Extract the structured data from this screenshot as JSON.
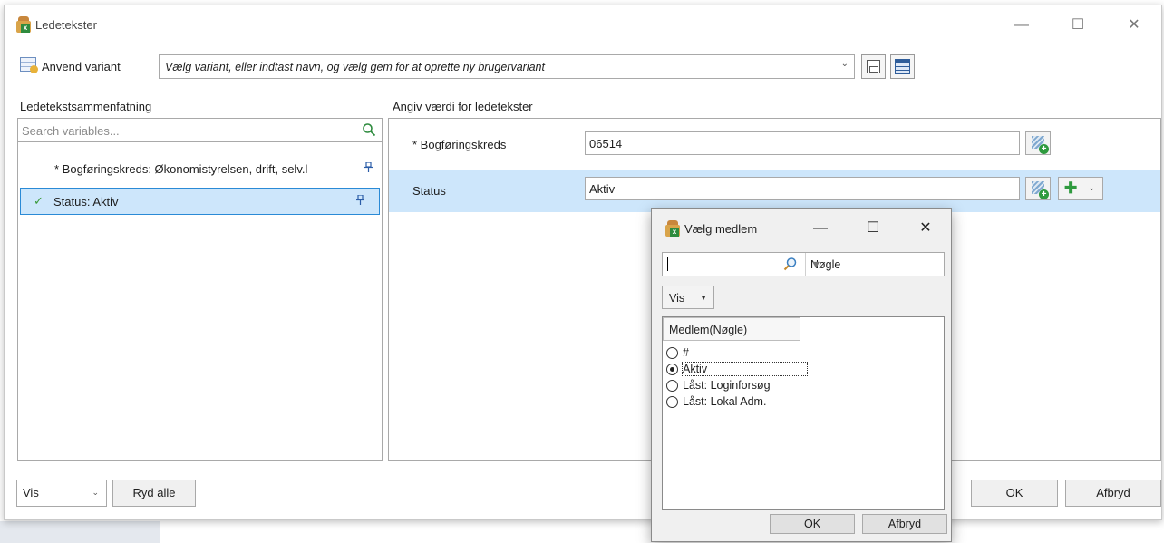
{
  "window": {
    "title": "Ledetekster",
    "minimize": "—",
    "maximize": "☐",
    "close": "✕"
  },
  "variant": {
    "label": "Anvend variant",
    "placeholder": "Vælg variant, eller indtast navn, og vælg gem for at oprette ny brugervariant",
    "arrow": "⌄"
  },
  "left": {
    "header": "Ledetekstsammenfatning",
    "search_placeholder": "Search variables...",
    "items": [
      {
        "text": "* Bogføringskreds: Økonomistyrelsen, drift, selv.l",
        "selected": false
      },
      {
        "text": "Status: Aktiv",
        "selected": true
      }
    ],
    "pin": "📌",
    "check": "✓"
  },
  "right": {
    "header": "Angiv værdi for ledetekster",
    "fields": [
      {
        "label": "* Bogføringskreds",
        "value": "06514"
      },
      {
        "label": "Status",
        "value": "Aktiv"
      }
    ]
  },
  "bottom": {
    "vis_label": "Vis",
    "clear_label": "Ryd alle",
    "ok_label": "OK",
    "cancel_label": "Afbryd"
  },
  "popup": {
    "title": "Vælg medlem",
    "key_label": "Nøgle",
    "vis_label": "Vis",
    "column_header": "Medlem(Nøgle)",
    "options": [
      {
        "label": "#",
        "checked": false
      },
      {
        "label": "Aktiv",
        "checked": true
      },
      {
        "label": "Låst: Loginforsøg",
        "checked": false
      },
      {
        "label": "Låst: Lokal Adm.",
        "checked": false
      }
    ],
    "ok_label": "OK",
    "cancel_label": "Afbryd"
  }
}
